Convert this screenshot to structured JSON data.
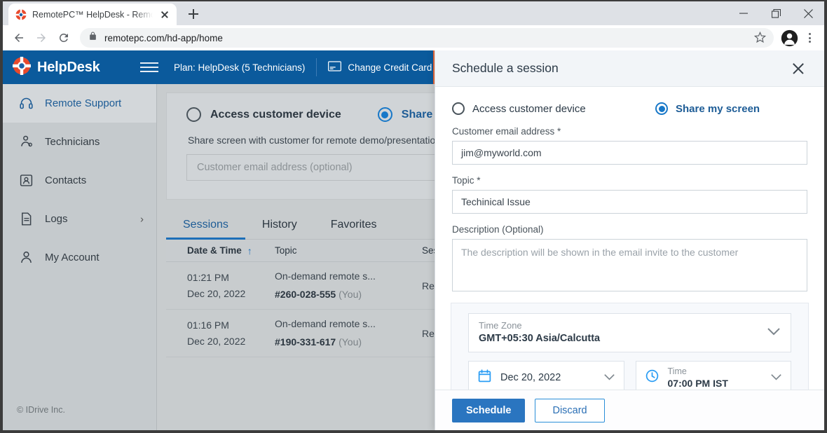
{
  "browser": {
    "tab_title": "RemotePC™ HelpDesk - Remote S",
    "url": "remotepc.com/hd-app/home",
    "newtab_label": "+",
    "minimize_label": "—",
    "maximize_label": "❐",
    "close_label": "✕"
  },
  "app_header": {
    "brand": "HelpDesk",
    "plan": "Plan: HelpDesk (5 Technicians)",
    "change_credit_card": "Change Credit Card",
    "accent_blue": "#0b5a9c",
    "accent_orange": "#e8683a"
  },
  "sidebar": {
    "items": [
      {
        "label": "Remote Support",
        "icon": "headset-icon",
        "active": true,
        "chevron": ""
      },
      {
        "label": "Technicians",
        "icon": "technicians-icon",
        "active": false,
        "chevron": ""
      },
      {
        "label": "Contacts",
        "icon": "contacts-icon",
        "active": false,
        "chevron": ""
      },
      {
        "label": "Logs",
        "icon": "document-icon",
        "active": false,
        "chevron": "›"
      },
      {
        "label": "My Account",
        "icon": "user-icon",
        "active": false,
        "chevron": ""
      }
    ],
    "copyright": "© IDrive Inc."
  },
  "main": {
    "radio_access": "Access customer device",
    "radio_share": "Share my screen",
    "share_description": "Share screen with customer for remote demo/presentation",
    "email_placeholder": "Customer email address (optional)",
    "tabs": [
      {
        "label": "Sessions",
        "active": true
      },
      {
        "label": "History",
        "active": false
      },
      {
        "label": "Favorites",
        "active": false
      }
    ],
    "table": {
      "columns": [
        "Date & Time",
        "Topic",
        "Sessio"
      ],
      "sort_arrow": "↑",
      "rows": [
        {
          "time": "01:21 PM",
          "date": "Dec 20, 2022",
          "topic": "On-demand remote s...",
          "session_id": "#260-028-555",
          "owner": "(You)",
          "type": "Remot"
        },
        {
          "time": "01:16 PM",
          "date": "Dec 20, 2022",
          "topic": "On-demand remote s...",
          "session_id": "#190-331-617",
          "owner": "(You)",
          "type": "Remot"
        }
      ]
    }
  },
  "modal": {
    "title": "Schedule a session",
    "radio_access": "Access customer device",
    "radio_share": "Share my screen",
    "email_label": "Customer email address *",
    "email_value": "jim@myworld.com",
    "topic_label": "Topic *",
    "topic_value": "Techinical Issue",
    "description_label": "Description (Optional)",
    "description_placeholder": "The description will be shown in the email invite to the customer",
    "timezone_label": "Time Zone",
    "timezone_value": "GMT+05:30 Asia/Calcutta",
    "date_value": "Dec 20, 2022",
    "time_label": "Time",
    "time_value": "07:00 PM IST",
    "schedule_button": "Schedule",
    "discard_button": "Discard"
  }
}
